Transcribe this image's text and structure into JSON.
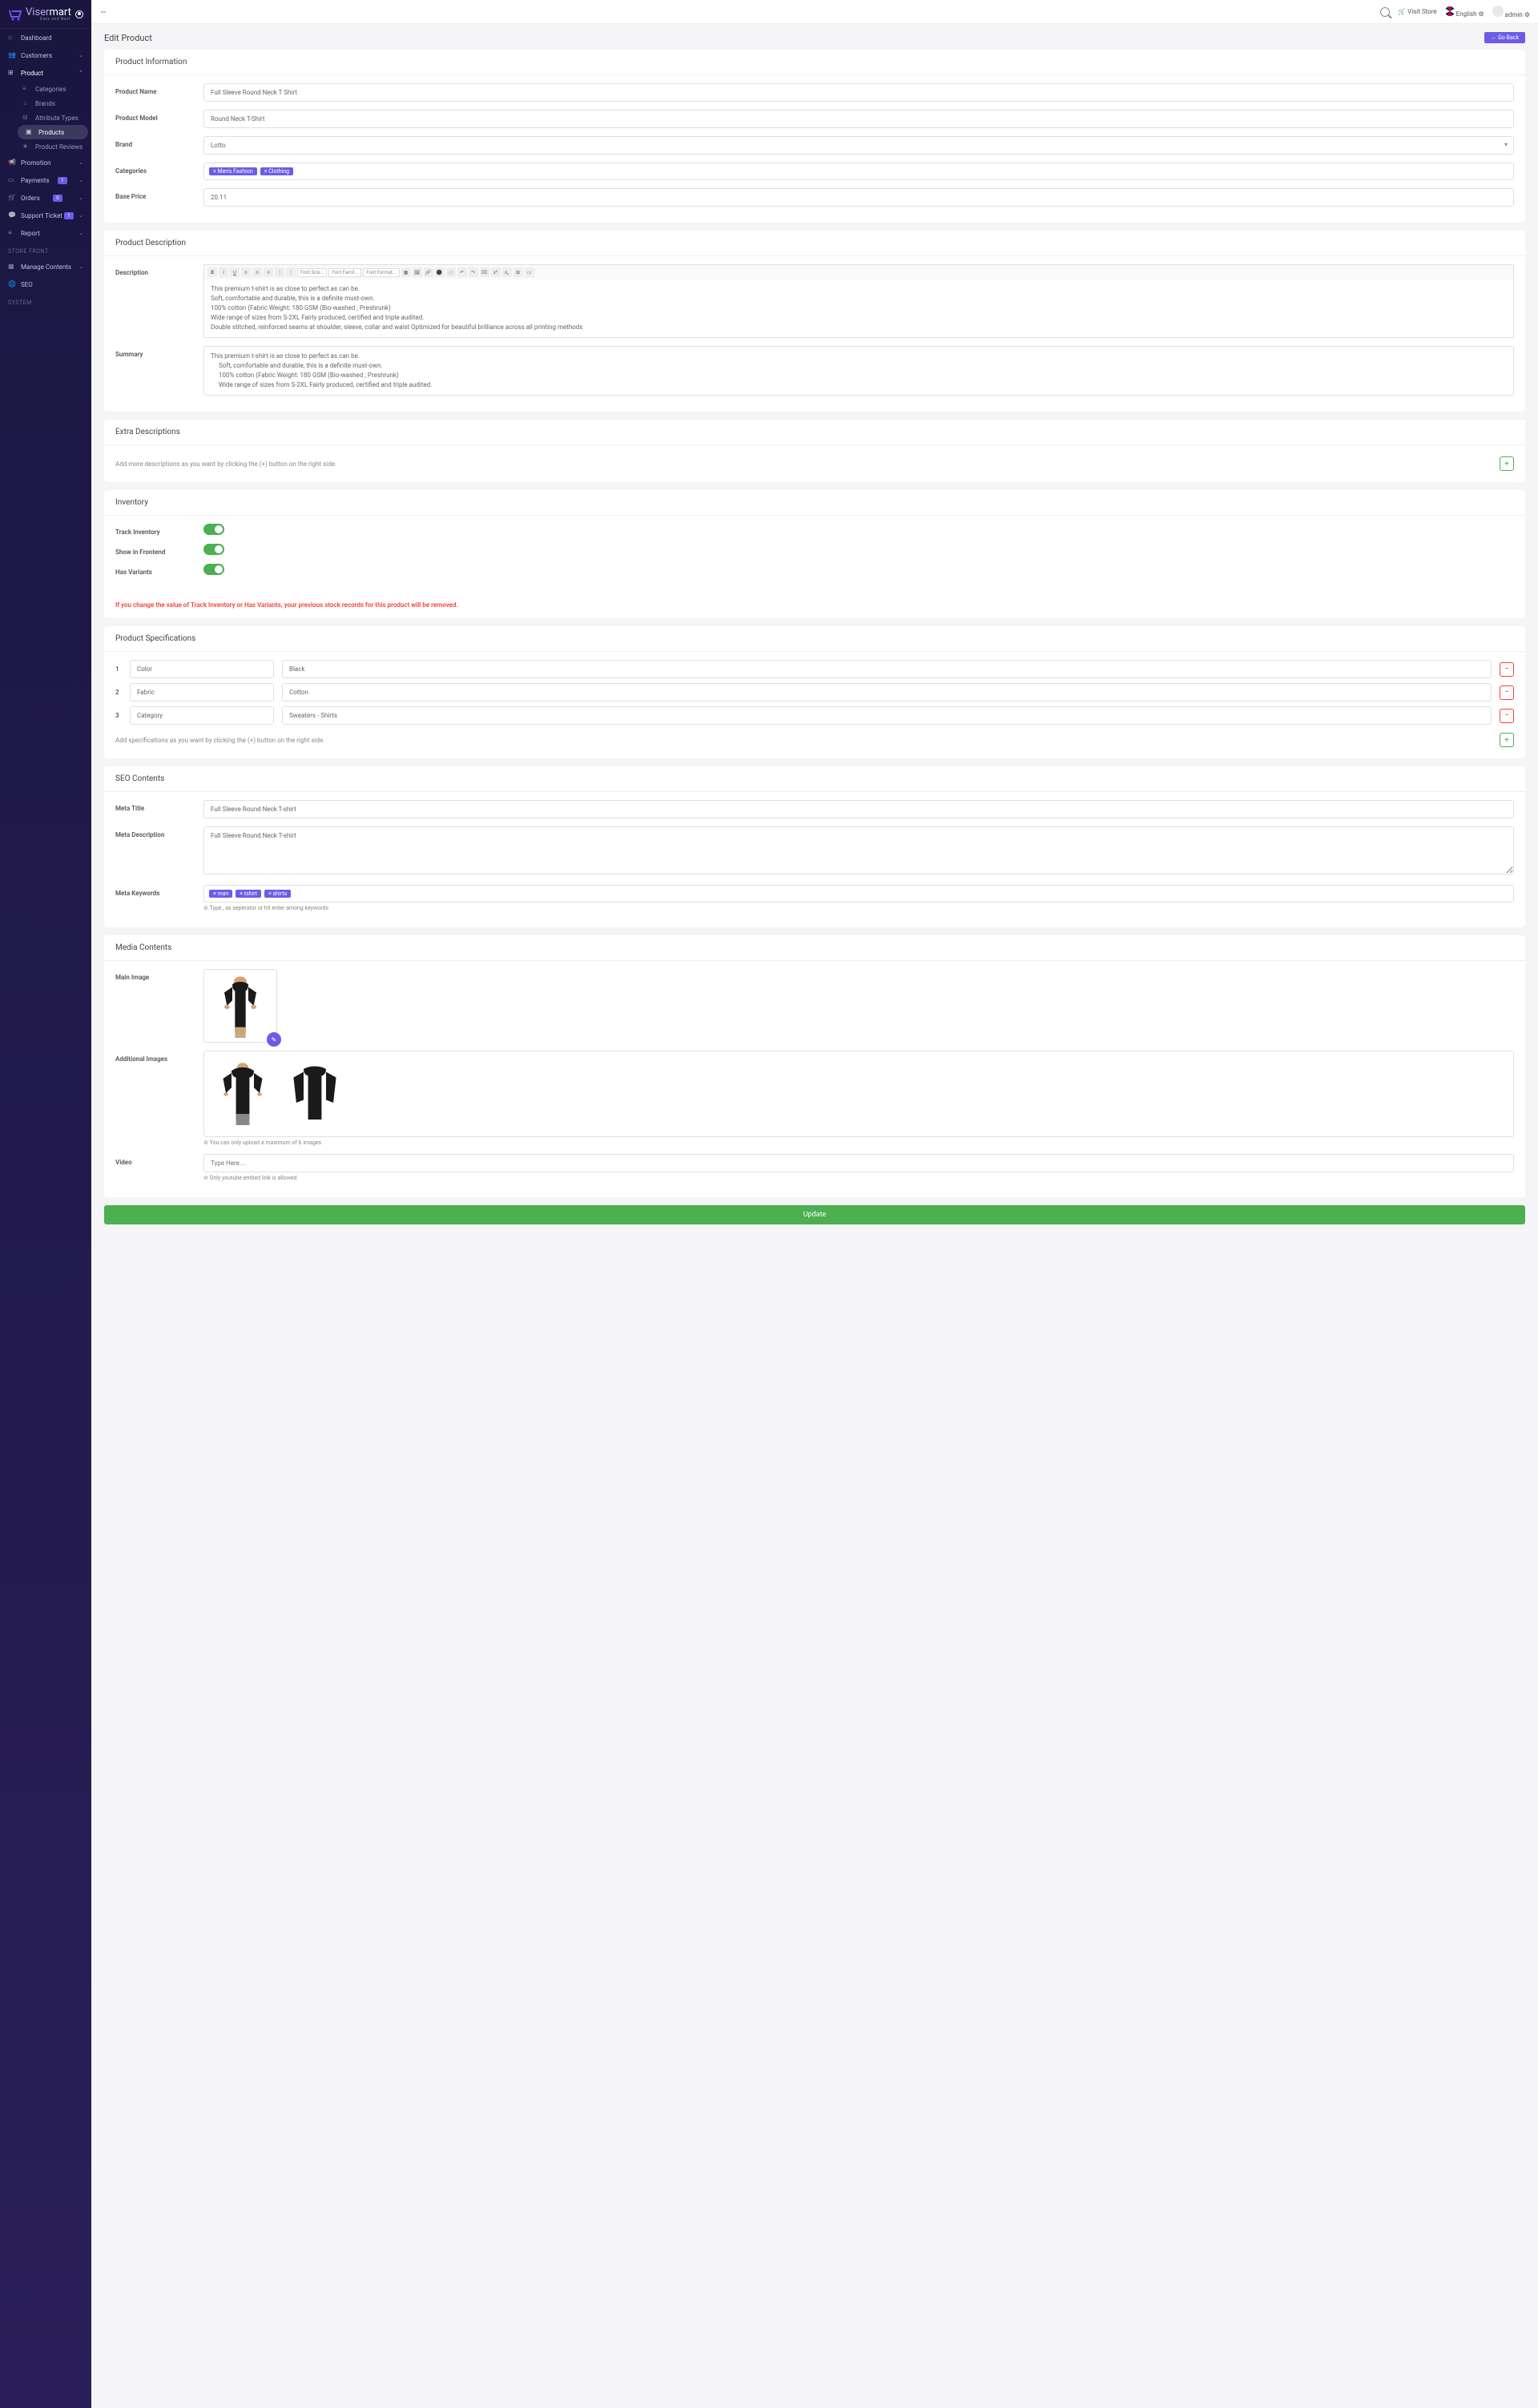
{
  "brand": {
    "name_1": "Viser",
    "name_2": "mart",
    "tagline": "Easy and Best"
  },
  "topbar": {
    "visit_store": "Visit Store",
    "language": "English",
    "user": "admin"
  },
  "sidebar": {
    "items": [
      {
        "label": "Dashboard"
      },
      {
        "label": "Customers"
      },
      {
        "label": "Product"
      },
      {
        "label": "Promotion"
      },
      {
        "label": "Payments",
        "badge": "1"
      },
      {
        "label": "Orders",
        "badge": "0"
      },
      {
        "label": "Support Ticket",
        "badge": "1"
      },
      {
        "label": "Report"
      }
    ],
    "product_sub": [
      {
        "label": "Categories"
      },
      {
        "label": "Brands"
      },
      {
        "label": "Attribute Types"
      },
      {
        "label": "Products"
      },
      {
        "label": "Product Reviews"
      }
    ],
    "store_front_header": "STORE FRONT",
    "store_front": [
      {
        "label": "Manage Contents"
      },
      {
        "label": "SEO"
      }
    ],
    "system_header": "SYSTEM"
  },
  "page": {
    "title": "Edit Product",
    "go_back": "Go Back"
  },
  "product_info": {
    "header": "Product Information",
    "name_label": "Product Name",
    "name_value": "Full Sleeve Round Neck T Shirt",
    "model_label": "Product Model",
    "model_value": "Round Neck T-Shirt",
    "brand_label": "Brand",
    "brand_value": "Lotto",
    "categories_label": "Categories",
    "category_tags": [
      "Men's Fashion",
      "Clothing"
    ],
    "price_label": "Base Price",
    "price_value": "20.11"
  },
  "description": {
    "header": "Product Description",
    "desc_label": "Description",
    "desc_lines": [
      "This premium t-shirt is as close to perfect as can be.",
      "Soft, comfortable and durable, this is a definite must-own.",
      "100% cotton (Fabric Weight: 180 GSM (Bio-washed ; Preshrunk)",
      "Wide range of sizes from S-2XL Fairly produced, certified and triple audited.",
      "Double stitched, reinforced seams at shoulder, sleeve, collar and waist Optimized for beautiful brilliance across all printing methods"
    ],
    "summary_label": "Summary",
    "summary_lines": [
      "This premium t-shirt is as close to perfect as can be.",
      "Soft, comfortable and durable, this is a definite must-own.",
      "100% cotton (Fabric Weight: 180 GSM (Bio-washed ; Preshrunk)",
      "Wide range of sizes from S-2XL Fairly produced, certified and triple audited."
    ],
    "editor": {
      "font_size": "Font Size...",
      "font_family": "Font Famil...",
      "format": "Font Format..."
    }
  },
  "extra": {
    "header": "Extra Descriptions",
    "helper": "Add more descriptions as you want by clicking the (+) button on the right side."
  },
  "inventory": {
    "header": "Inventory",
    "track_label": "Track Inventory",
    "show_label": "Show in Frontend",
    "variants_label": "Has Variants",
    "warning": "If you change the value of Track Inventory or Has Variants, your previous stock records for this product will be removed."
  },
  "specs": {
    "header": "Product Specifications",
    "rows": [
      {
        "n": "1",
        "key": "Color",
        "val": "Black"
      },
      {
        "n": "2",
        "key": "Fabric",
        "val": "Cotton"
      },
      {
        "n": "3",
        "key": "Category",
        "val": "Sweaters - Shirts"
      }
    ],
    "helper": "Add specifications as you want by clicking the (+) button on the right side."
  },
  "seo": {
    "header": "SEO Contents",
    "title_label": "Meta Title",
    "title_value": "Full Sleeve Round Neck T-shirt",
    "desc_label": "Meta Description",
    "desc_value": "Full Sleeve Round Neck T-shirt",
    "keywords_label": "Meta Keywords",
    "keyword_tags": [
      "man",
      "tshirt",
      "shirts"
    ],
    "keywords_helper": "Type , as seperator or hit enter among keywords"
  },
  "media": {
    "header": "Media Contents",
    "main_label": "Main Image",
    "additional_label": "Additional Images",
    "additional_helper": "You can only upload a maximum of 6 images",
    "video_label": "Video",
    "video_placeholder": "Type Here....",
    "video_helper": "Only youtube embed link is allowed"
  },
  "update_btn": "Update"
}
